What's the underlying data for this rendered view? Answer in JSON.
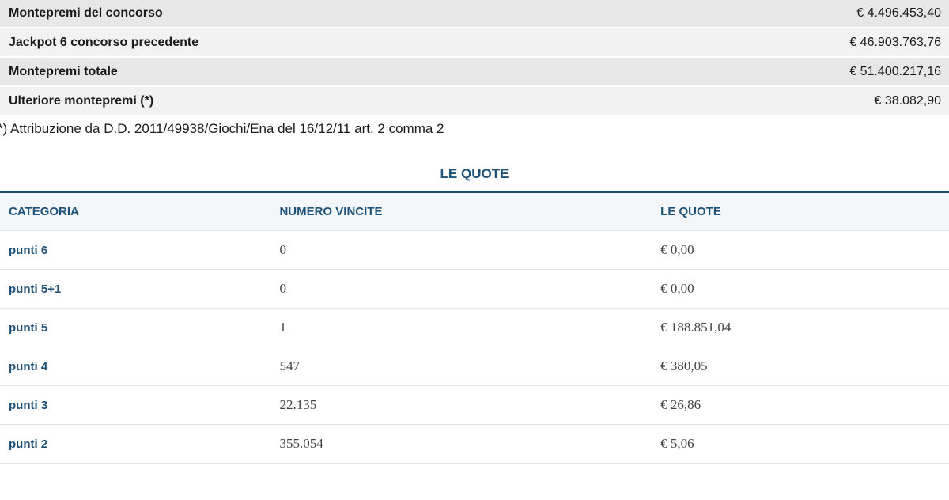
{
  "summary": {
    "rows": [
      {
        "label": "Montepremi del concorso",
        "value": "€ 4.496.453,40"
      },
      {
        "label": "Jackpot 6 concorso precedente",
        "value": "€ 46.903.763,76"
      },
      {
        "label": "Montepremi totale",
        "value": "€ 51.400.217,16"
      },
      {
        "label": "Ulteriore montepremi (*)",
        "value": "€ 38.082,90"
      }
    ],
    "footnote": "*) Attribuzione da D.D. 2011/49938/Giochi/Ena del 16/12/11 art. 2 comma 2"
  },
  "quote": {
    "title": "LE QUOTE",
    "headers": {
      "categoria": "CATEGORIA",
      "numero_vincite": "NUMERO VINCITE",
      "le_quote": "LE QUOTE"
    },
    "rows": [
      {
        "categoria": "punti 6",
        "vincite": "0",
        "quota": "€ 0,00"
      },
      {
        "categoria": "punti 5+1",
        "vincite": "0",
        "quota": "€ 0,00"
      },
      {
        "categoria": "punti 5",
        "vincite": "1",
        "quota": "€ 188.851,04"
      },
      {
        "categoria": "punti 4",
        "vincite": "547",
        "quota": "€ 380,05"
      },
      {
        "categoria": "punti 3",
        "vincite": "22.135",
        "quota": "€ 26,86"
      },
      {
        "categoria": "punti 2",
        "vincite": "355.054",
        "quota": "€ 5,06"
      }
    ]
  }
}
